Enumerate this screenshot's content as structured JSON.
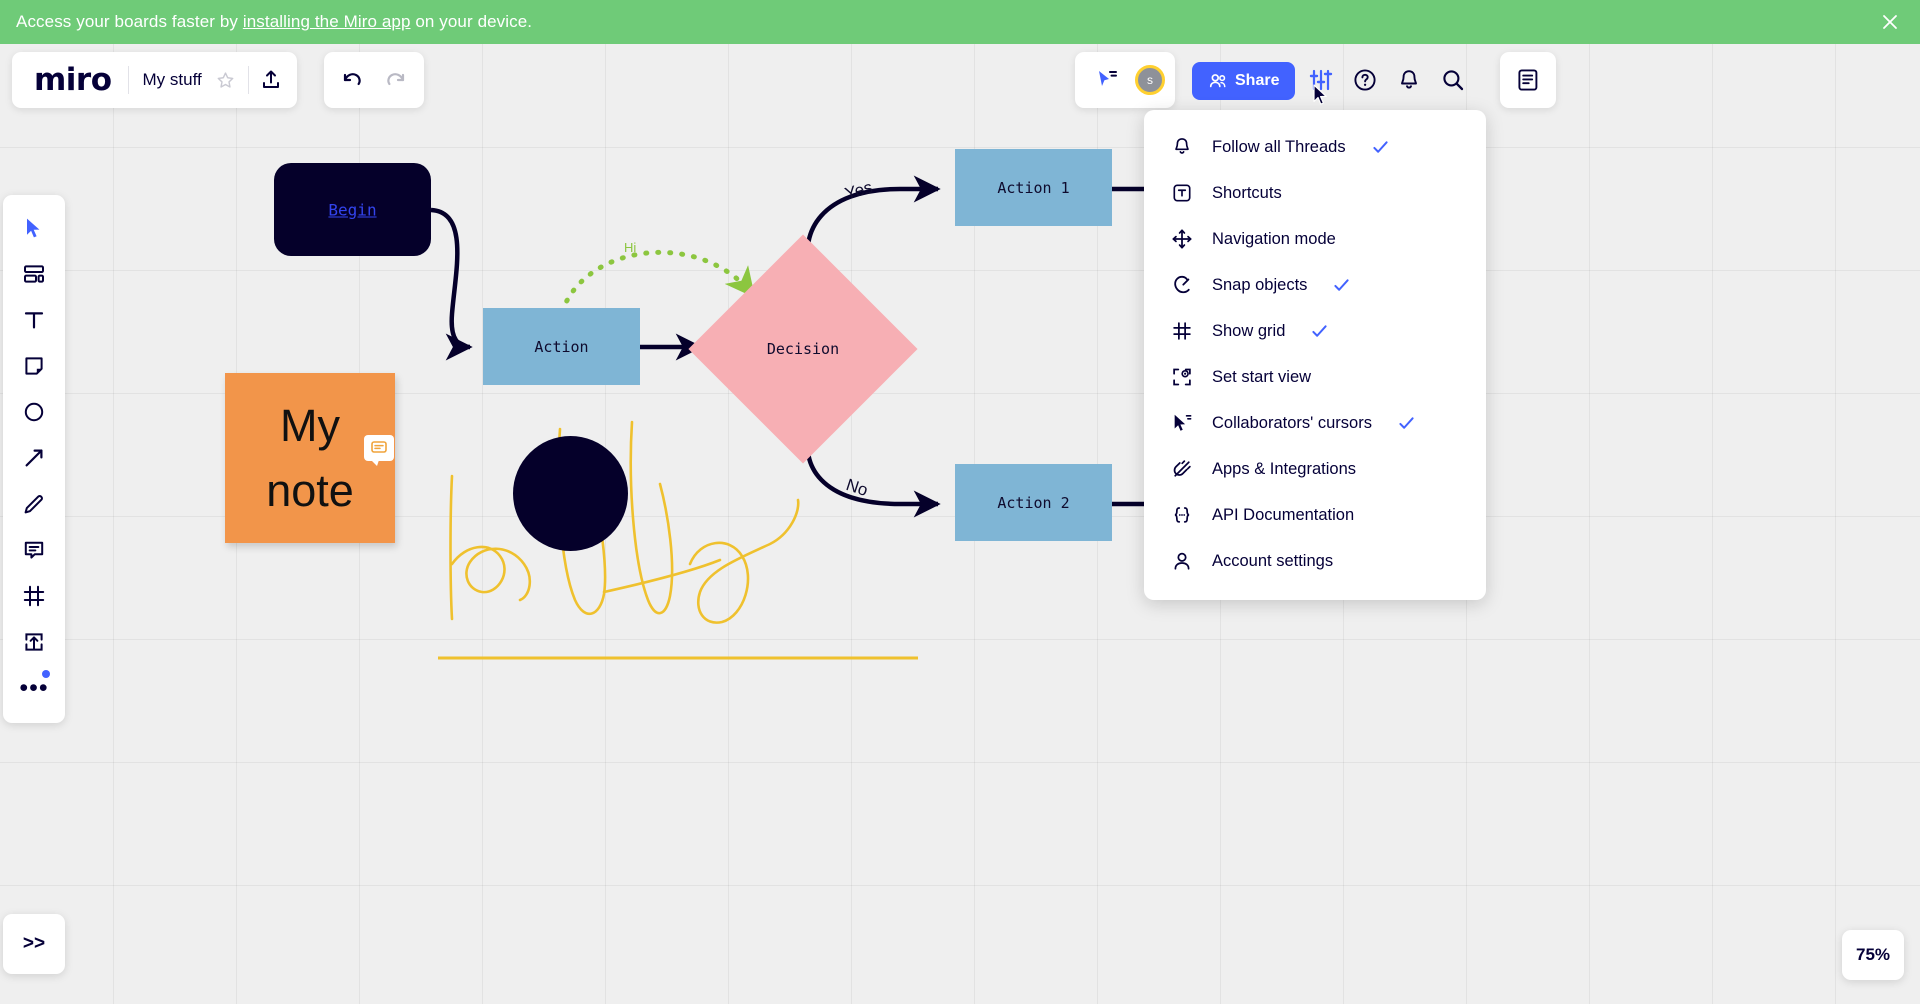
{
  "banner": {
    "text_before": "Access your boards faster by ",
    "link": "installing the Miro app",
    "text_after": " on your device.",
    "close_icon": "close-icon",
    "background": "#6fcb78"
  },
  "toolbar": {
    "logo": "miro",
    "board_name": "My stuff",
    "star_icon": "star-icon",
    "export_icon": "upload-icon",
    "undo_icon": "undo-icon",
    "redo_icon": "redo-icon",
    "collab_cursor_icon": "collaborator-cursor-icon",
    "avatar_initial": "s",
    "share_label": "Share",
    "share_icon": "people-icon",
    "settings_icon": "sliders-icon",
    "help_icon": "question-circle-icon",
    "notifications_icon": "bell-icon",
    "search_icon": "search-icon",
    "notes_icon": "notes-panel-icon",
    "accent_color": "#4262ff"
  },
  "menu": {
    "items": [
      {
        "icon": "bell-icon",
        "label": "Follow all Threads",
        "checked": true
      },
      {
        "icon": "keyboard-key-icon",
        "label": "Shortcuts",
        "checked": false
      },
      {
        "icon": "move-arrows-icon",
        "label": "Navigation mode",
        "checked": false
      },
      {
        "icon": "magnet-icon",
        "label": "Snap objects",
        "checked": true
      },
      {
        "icon": "grid-icon",
        "label": "Show grid",
        "checked": true
      },
      {
        "icon": "set-start-view-icon",
        "label": "Set start view",
        "checked": false
      },
      {
        "icon": "cursor-pointer-icon",
        "label": "Collaborators' cursors",
        "checked": true
      },
      {
        "icon": "plug-icon",
        "label": "Apps & Integrations",
        "checked": false
      },
      {
        "icon": "braces-icon",
        "label": "API Documentation",
        "checked": false
      },
      {
        "icon": "person-icon",
        "label": "Account settings",
        "checked": false
      }
    ],
    "check_color": "#4262ff"
  },
  "left_toolbar": {
    "tools": [
      {
        "icon": "select-cursor-icon",
        "name": "select-tool",
        "active": true
      },
      {
        "icon": "templates-icon",
        "name": "templates-tool",
        "active": false
      },
      {
        "icon": "text-icon",
        "name": "text-tool",
        "active": false
      },
      {
        "icon": "sticky-note-icon",
        "name": "sticky-note-tool",
        "active": false
      },
      {
        "icon": "shapes-circle-icon",
        "name": "shapes-tool",
        "active": false
      },
      {
        "icon": "connector-arrow-icon",
        "name": "connector-tool",
        "active": false
      },
      {
        "icon": "pen-icon",
        "name": "pen-tool",
        "active": false
      },
      {
        "icon": "comment-icon",
        "name": "comment-tool",
        "active": false
      },
      {
        "icon": "frame-icon",
        "name": "frame-tool",
        "active": false
      },
      {
        "icon": "upload-icon",
        "name": "upload-tool",
        "active": false
      },
      {
        "icon": "more-dots-icon",
        "name": "more-tools",
        "active": false
      }
    ]
  },
  "board": {
    "begin_label": "Begin",
    "action_label": "Action",
    "decision_label": "Decision",
    "action1_label": "Action 1",
    "action2_label": "Action 2",
    "yes_label": "Yes",
    "no_label": "No",
    "hi_label": "Hi",
    "sticky_line1": "My",
    "sticky_line2": "note",
    "sticky_color": "#F2954A",
    "action_color": "#7FB5D5",
    "decision_color": "#F7AFB4",
    "dark_color": "#05002a",
    "scribble_color": "#efc12e",
    "dotted_arrow_color": "#8cc63f",
    "sticky_badge_icon": "comment-badge-icon"
  },
  "footer": {
    "expand_label": ">>",
    "zoom_level": "75%"
  }
}
